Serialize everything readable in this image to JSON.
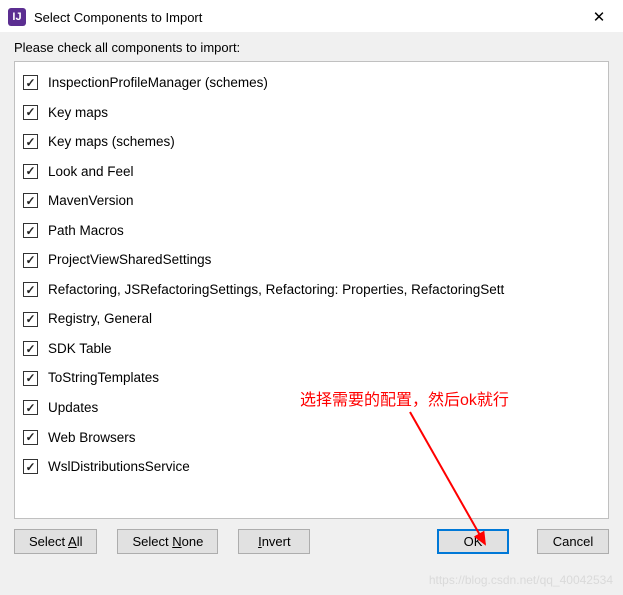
{
  "window": {
    "title": "Select Components to Import",
    "icon_letter": "IJ"
  },
  "instruction": "Please check all components to import:",
  "components": [
    {
      "label": "InspectionProfileManager (schemes)",
      "checked": true
    },
    {
      "label": "Key maps",
      "checked": true
    },
    {
      "label": "Key maps (schemes)",
      "checked": true
    },
    {
      "label": "Look and Feel",
      "checked": true
    },
    {
      "label": "MavenVersion",
      "checked": true
    },
    {
      "label": "Path Macros",
      "checked": true
    },
    {
      "label": "ProjectViewSharedSettings",
      "checked": true
    },
    {
      "label": "Refactoring, JSRefactoringSettings, Refactoring: Properties, RefactoringSett",
      "checked": true
    },
    {
      "label": "Registry, General",
      "checked": true
    },
    {
      "label": "SDK Table",
      "checked": true
    },
    {
      "label": "ToStringTemplates",
      "checked": true
    },
    {
      "label": "Updates",
      "checked": true
    },
    {
      "label": "Web Browsers",
      "checked": true
    },
    {
      "label": "WslDistributionsService",
      "checked": true
    }
  ],
  "buttons": {
    "select_all": "Select All",
    "select_none": "Select None",
    "invert": "Invert",
    "ok": "OK",
    "cancel": "Cancel"
  },
  "annotation_text": "选择需要的配置，然后ok就行",
  "watermark": "https://blog.csdn.net/qq_40042534"
}
